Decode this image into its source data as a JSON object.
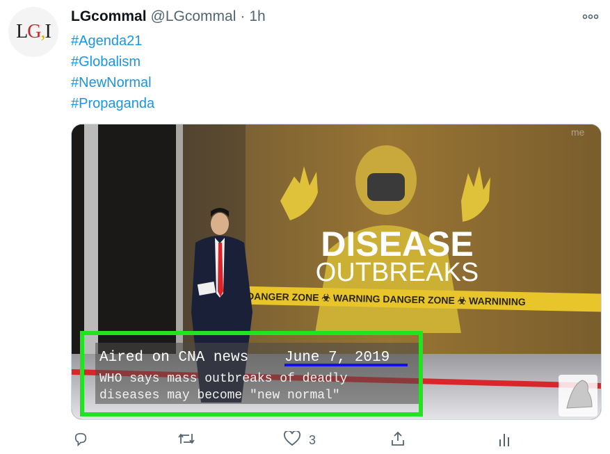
{
  "tweet": {
    "avatar_letters": [
      "L",
      "G",
      ",",
      "I"
    ],
    "display_name": "LGcommal",
    "handle": "@LGcommal",
    "separator": "·",
    "time": "1h",
    "hashtags": [
      "#Agenda21",
      "#Globalism",
      "#NewNormal",
      "#Propaganda"
    ]
  },
  "media": {
    "headline_line1": "DISEASE",
    "headline_line2": "OUTBREAKS",
    "tape_text": "DANGER ZONE ☣ WARNING DANGER ZONE ☣ WARNINING",
    "watermark": "me",
    "caption_line1_part1": "Aired on CNA news ",
    "caption_line1_date": "June 7, 2019",
    "caption_line2": "WHO says mass outbreaks of deadly",
    "caption_line3": "diseases may become \"new normal\"",
    "highlight_color": "#1fe41f",
    "underline_color": "#1010e8"
  },
  "actions": {
    "reply_count": "",
    "retweet_count": "",
    "like_count": "3",
    "icons": [
      "reply-icon",
      "retweet-icon",
      "like-icon",
      "share-icon",
      "analytics-icon"
    ]
  },
  "colors": {
    "link": "#1b95e0",
    "muted": "#536471"
  }
}
